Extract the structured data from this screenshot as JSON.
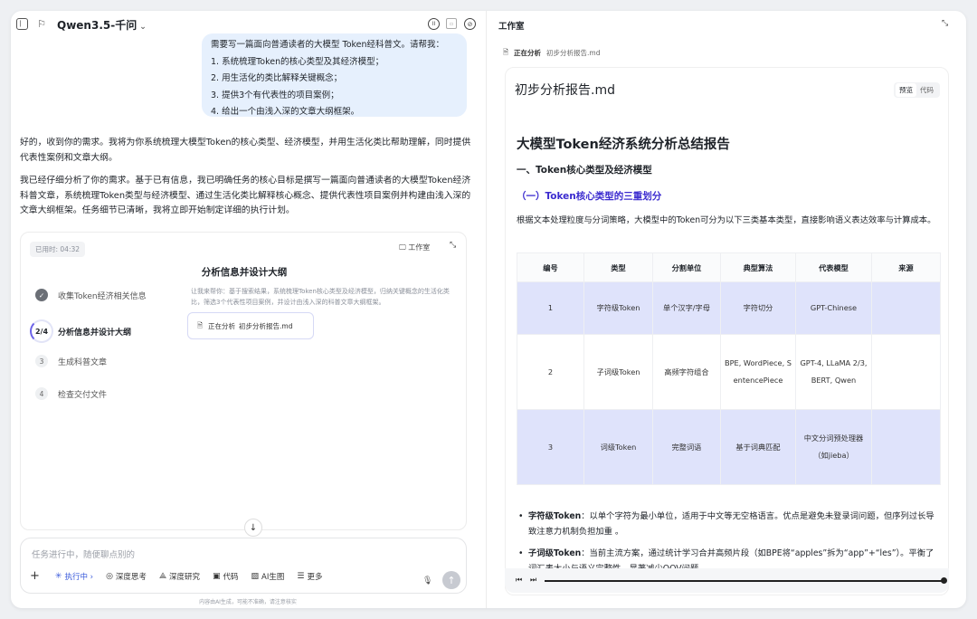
{
  "topbar": {
    "model": "Qwen3.5-千问"
  },
  "user_message": {
    "lines": [
      "需要写一篇面向普通读者的大模型 Token经科普文。请帮我：",
      "1. 系统梳理Token的核心类型及其经济模型；",
      "2. 用生活化的类比解释关键概念；",
      "3. 提供3个有代表性的项目案例；",
      "4. 给出一个由浅入深的文章大纲框架。"
    ]
  },
  "assistant": {
    "para1": "好的，收到你的需求。我将为你系统梳理大模型Token的核心类型、经济模型，并用生活化类比帮助理解，同时提供代表性案例和文章大纲。",
    "para2": "我已经仔细分析了你的需求。基于已有信息，我已明确任务的核心目标是撰写一篇面向普通读者的大模型Token经济科普文章，系统梳理Token类型与经济模型、通过生活化类比解释核心概念、提供代表性项目案例并构建由浅入深的文章大纲框架。任务细节已清晰，我将立即开始制定详细的执行计划。"
  },
  "task": {
    "elapsed": "已用时: 04:32",
    "workspace_label": "工作室",
    "title": "分析信息并设计大纲",
    "steps": [
      {
        "num": "✓",
        "label": "收集Token经济相关信息"
      },
      {
        "num": "2/4",
        "label": "分析信息并设计大纲"
      },
      {
        "num": "3",
        "label": "生成科普文章"
      },
      {
        "num": "4",
        "label": "检查交付文件"
      }
    ],
    "description": "让我来帮你：基于搜索结果，系统梳理Token核心类型及经济模型，归纳关键概念的生活化类比，筛选3个代表性项目案例，并设计由浅入深的科普文章大纲框架。",
    "file_chip": {
      "status": "正在分析",
      "filename": "初步分析报告.md"
    }
  },
  "input": {
    "placeholder": "任务进行中，随便聊点别的",
    "tools": [
      {
        "icon": "+",
        "label": ""
      },
      {
        "icon": "✳",
        "label": "执行中 ›"
      },
      {
        "icon": "◎",
        "label": "深度思考"
      },
      {
        "icon": "⟁",
        "label": "深度研究"
      },
      {
        "icon": "▣",
        "label": "代码"
      },
      {
        "icon": "▨",
        "label": "AI生图"
      },
      {
        "icon": "☰",
        "label": "更多"
      }
    ]
  },
  "footnote": "内容由AI生成，可能不准确，请注意核实",
  "workspace": {
    "title": "工作室",
    "status": "正在分析",
    "status_file": "初步分析报告.md",
    "doc_title": "初步分析报告.md",
    "toggle": [
      "预览",
      "代码"
    ],
    "h1": "大模型Token经济系统分析总结报告",
    "h2": "一、Token核心类型及经济模型",
    "h3": "（一）Token核心类型的三重划分",
    "intro": "根据文本处理粒度与分词策略，大模型中的Token可分为以下三类基本类型，直接影响语义表达效率与计算成本。",
    "table": {
      "headers": [
        "编号",
        "类型",
        "分割单位",
        "典型算法",
        "代表模型",
        "来源"
      ],
      "rows": [
        [
          "1",
          "字符级Token",
          "单个汉字/字母",
          "字符切分",
          "GPT-Chinese",
          ""
        ],
        [
          "2",
          "子词级Token",
          "高频字符组合",
          "BPE, WordPiece, SentencePiece",
          "GPT-4, LLaMA 2/3, BERT, Qwen",
          ""
        ],
        [
          "3",
          "词级Token",
          "完整词语",
          "基于词典匹配",
          "中文分词预处理器（如jieba）",
          ""
        ]
      ]
    },
    "bullets": [
      {
        "bold": "字符级Token",
        "text": "：以单个字符为最小单位，适用于中文等无空格语言。优点是避免未登录词问题，但序列过长导致注意力机制负担加重 。"
      },
      {
        "bold": "子词级Token",
        "text": "：当前主流方案，通过统计学习合并高频片段（如BPE将“apples”拆为“app”+“les”）。平衡了词汇表大小与语义完整性，显著减少OOV问题 。"
      }
    ]
  }
}
